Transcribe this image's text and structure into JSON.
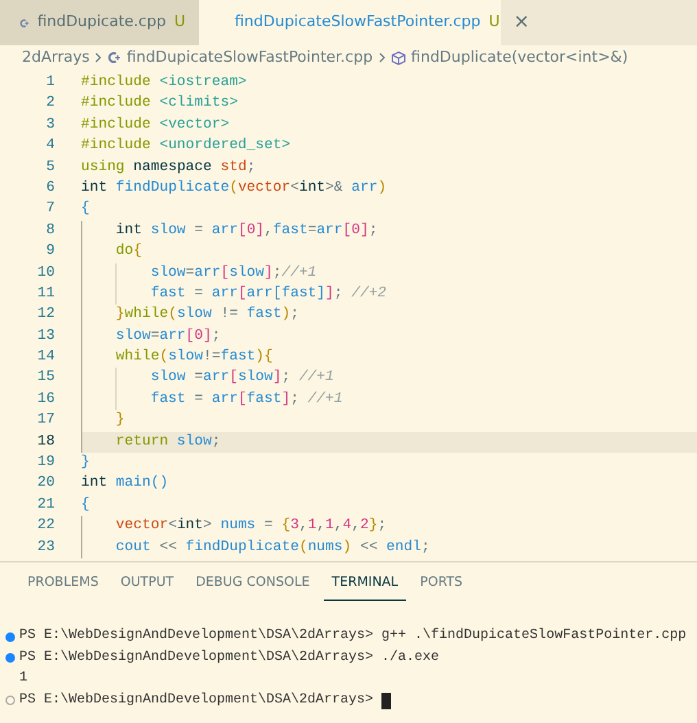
{
  "tabs": [
    {
      "label": "findDupicate.cpp",
      "badge": "U",
      "selected": false
    },
    {
      "label": "findDupicateSlowFastPointer.cpp",
      "badge": "U",
      "selected": true,
      "close": "×"
    }
  ],
  "breadcrumb": [
    {
      "label": "2dArrays",
      "kind": "folder"
    },
    {
      "label": "findDupicateSlowFastPointer.cpp",
      "kind": "file"
    },
    {
      "label": "findDuplicate(vector<int>&)",
      "kind": "symbol"
    }
  ],
  "code": [
    {
      "number": "1",
      "current": false,
      "tokens": [
        {
          "text": "#include",
          "kind": "pre"
        },
        {
          "text": " <iostream>",
          "kind": "inc"
        }
      ]
    },
    {
      "number": "2",
      "current": false,
      "tokens": [
        {
          "text": "#include",
          "kind": "pre"
        },
        {
          "text": " <climits>",
          "kind": "inc"
        }
      ]
    },
    {
      "number": "3",
      "current": false,
      "tokens": [
        {
          "text": "#include",
          "kind": "pre"
        },
        {
          "text": " <vector>",
          "kind": "inc"
        }
      ]
    },
    {
      "number": "4",
      "current": false,
      "tokens": [
        {
          "text": "#include",
          "kind": "pre"
        },
        {
          "text": " <unordered_set>",
          "kind": "inc"
        }
      ]
    },
    {
      "number": "5",
      "current": false,
      "tokens": [
        {
          "text": "using",
          "kind": "kw"
        },
        {
          "text": " namespace",
          "kind": "type"
        },
        {
          "text": " std",
          "kind": "ns"
        },
        {
          "text": ";",
          "kind": "op"
        }
      ]
    },
    {
      "number": "6",
      "current": false,
      "tokens": [
        {
          "text": "int",
          "kind": "type"
        },
        {
          "text": " findDuplicate",
          "kind": "fn"
        },
        {
          "text": "(",
          "kind": "b1"
        },
        {
          "text": "vector",
          "kind": "ns"
        },
        {
          "text": "<",
          "kind": "op"
        },
        {
          "text": "int",
          "kind": "type"
        },
        {
          "text": ">&",
          "kind": "op"
        },
        {
          "text": " arr",
          "kind": "var"
        },
        {
          "text": ")",
          "kind": "b1"
        }
      ]
    },
    {
      "number": "7",
      "current": false,
      "tokens": [
        {
          "text": "{",
          "kind": "b3"
        }
      ]
    },
    {
      "number": "8",
      "current": false,
      "tokens": [
        {
          "text": "    int",
          "kind": "type"
        },
        {
          "text": " slow",
          "kind": "var"
        },
        {
          "text": " = ",
          "kind": "op"
        },
        {
          "text": "arr",
          "kind": "var"
        },
        {
          "text": "[",
          "kind": "b2"
        },
        {
          "text": "0",
          "kind": "num"
        },
        {
          "text": "]",
          "kind": "b2"
        },
        {
          "text": ",",
          "kind": "op"
        },
        {
          "text": "fast",
          "kind": "var"
        },
        {
          "text": "=",
          "kind": "op"
        },
        {
          "text": "arr",
          "kind": "var"
        },
        {
          "text": "[",
          "kind": "b2"
        },
        {
          "text": "0",
          "kind": "num"
        },
        {
          "text": "]",
          "kind": "b2"
        },
        {
          "text": ";",
          "kind": "op"
        }
      ]
    },
    {
      "number": "9",
      "current": false,
      "tokens": [
        {
          "text": "    do",
          "kind": "kw"
        },
        {
          "text": "{",
          "kind": "b1"
        }
      ]
    },
    {
      "number": "10",
      "current": false,
      "tokens": [
        {
          "text": "        slow",
          "kind": "var"
        },
        {
          "text": "=",
          "kind": "op"
        },
        {
          "text": "arr",
          "kind": "var"
        },
        {
          "text": "[",
          "kind": "b2"
        },
        {
          "text": "slow",
          "kind": "var"
        },
        {
          "text": "]",
          "kind": "b2"
        },
        {
          "text": ";",
          "kind": "op"
        },
        {
          "text": "//+1",
          "kind": "cmt"
        }
      ]
    },
    {
      "number": "11",
      "current": false,
      "tokens": [
        {
          "text": "        fast",
          "kind": "var"
        },
        {
          "text": " = ",
          "kind": "op"
        },
        {
          "text": "arr",
          "kind": "var"
        },
        {
          "text": "[",
          "kind": "b2"
        },
        {
          "text": "arr",
          "kind": "var"
        },
        {
          "text": "[",
          "kind": "b3"
        },
        {
          "text": "fast",
          "kind": "var"
        },
        {
          "text": "]",
          "kind": "b3"
        },
        {
          "text": "]",
          "kind": "b2"
        },
        {
          "text": ";",
          "kind": "op"
        },
        {
          "text": " //+2",
          "kind": "cmt"
        }
      ]
    },
    {
      "number": "12",
      "current": false,
      "tokens": [
        {
          "text": "    }",
          "kind": "b1"
        },
        {
          "text": "while",
          "kind": "kw"
        },
        {
          "text": "(",
          "kind": "b1"
        },
        {
          "text": "slow",
          "kind": "var"
        },
        {
          "text": " != ",
          "kind": "op"
        },
        {
          "text": "fast",
          "kind": "var"
        },
        {
          "text": ")",
          "kind": "b1"
        },
        {
          "text": ";",
          "kind": "op"
        }
      ]
    },
    {
      "number": "13",
      "current": false,
      "tokens": [
        {
          "text": "    slow",
          "kind": "var"
        },
        {
          "text": "=",
          "kind": "op"
        },
        {
          "text": "arr",
          "kind": "var"
        },
        {
          "text": "[",
          "kind": "b2"
        },
        {
          "text": "0",
          "kind": "num"
        },
        {
          "text": "]",
          "kind": "b2"
        },
        {
          "text": ";",
          "kind": "op"
        }
      ]
    },
    {
      "number": "14",
      "current": false,
      "tokens": [
        {
          "text": "    while",
          "kind": "kw"
        },
        {
          "text": "(",
          "kind": "b1"
        },
        {
          "text": "slow",
          "kind": "var"
        },
        {
          "text": "!=",
          "kind": "op"
        },
        {
          "text": "fast",
          "kind": "var"
        },
        {
          "text": ")",
          "kind": "b1"
        },
        {
          "text": "{",
          "kind": "b1"
        }
      ]
    },
    {
      "number": "15",
      "current": false,
      "tokens": [
        {
          "text": "        slow",
          "kind": "var"
        },
        {
          "text": " =",
          "kind": "op"
        },
        {
          "text": "arr",
          "kind": "var"
        },
        {
          "text": "[",
          "kind": "b2"
        },
        {
          "text": "slow",
          "kind": "var"
        },
        {
          "text": "]",
          "kind": "b2"
        },
        {
          "text": ";",
          "kind": "op"
        },
        {
          "text": " //+1",
          "kind": "cmt"
        }
      ]
    },
    {
      "number": "16",
      "current": false,
      "tokens": [
        {
          "text": "        fast",
          "kind": "var"
        },
        {
          "text": " = ",
          "kind": "op"
        },
        {
          "text": "arr",
          "kind": "var"
        },
        {
          "text": "[",
          "kind": "b2"
        },
        {
          "text": "fast",
          "kind": "var"
        },
        {
          "text": "]",
          "kind": "b2"
        },
        {
          "text": ";",
          "kind": "op"
        },
        {
          "text": " //+1",
          "kind": "cmt"
        }
      ]
    },
    {
      "number": "17",
      "current": false,
      "tokens": [
        {
          "text": "    }",
          "kind": "b1"
        }
      ]
    },
    {
      "number": "18",
      "current": true,
      "tokens": [
        {
          "text": "    return",
          "kind": "kw"
        },
        {
          "text": " slow",
          "kind": "var"
        },
        {
          "text": ";",
          "kind": "op"
        }
      ]
    },
    {
      "number": "19",
      "current": false,
      "tokens": [
        {
          "text": "}",
          "kind": "b3"
        }
      ]
    },
    {
      "number": "20",
      "current": false,
      "tokens": [
        {
          "text": "int",
          "kind": "type"
        },
        {
          "text": " main",
          "kind": "fn"
        },
        {
          "text": "()",
          "kind": "b3"
        }
      ]
    },
    {
      "number": "21",
      "current": false,
      "tokens": [
        {
          "text": "{",
          "kind": "b3"
        }
      ]
    },
    {
      "number": "22",
      "current": false,
      "tokens": [
        {
          "text": "    vector",
          "kind": "ns"
        },
        {
          "text": "<",
          "kind": "op"
        },
        {
          "text": "int",
          "kind": "type"
        },
        {
          "text": ">",
          "kind": "op"
        },
        {
          "text": " nums",
          "kind": "var"
        },
        {
          "text": " = ",
          "kind": "op"
        },
        {
          "text": "{",
          "kind": "b1"
        },
        {
          "text": "3",
          "kind": "num"
        },
        {
          "text": ",",
          "kind": "op"
        },
        {
          "text": "1",
          "kind": "num"
        },
        {
          "text": ",",
          "kind": "op"
        },
        {
          "text": "1",
          "kind": "num"
        },
        {
          "text": ",",
          "kind": "op"
        },
        {
          "text": "4",
          "kind": "num"
        },
        {
          "text": ",",
          "kind": "op"
        },
        {
          "text": "2",
          "kind": "num"
        },
        {
          "text": "}",
          "kind": "b1"
        },
        {
          "text": ";",
          "kind": "op"
        }
      ]
    },
    {
      "number": "23",
      "current": false,
      "tokens": [
        {
          "text": "    cout",
          "kind": "var"
        },
        {
          "text": " << ",
          "kind": "op"
        },
        {
          "text": "findDuplicate",
          "kind": "fn"
        },
        {
          "text": "(",
          "kind": "b1"
        },
        {
          "text": "nums",
          "kind": "var"
        },
        {
          "text": ")",
          "kind": "b1"
        },
        {
          "text": " << ",
          "kind": "op"
        },
        {
          "text": "endl",
          "kind": "var"
        },
        {
          "text": ";",
          "kind": "op"
        }
      ]
    }
  ],
  "panel_tabs": [
    {
      "label": "PROBLEMS",
      "selected": false
    },
    {
      "label": "OUTPUT",
      "selected": false
    },
    {
      "label": "DEBUG CONSOLE",
      "selected": false
    },
    {
      "label": "TERMINAL",
      "selected": true
    },
    {
      "label": "PORTS",
      "selected": false
    }
  ],
  "terminal": [
    {
      "kind": "command",
      "text": "PS E:\\WebDesignAndDevelopment\\DSA\\2dArrays> g++ .\\findDupicateSlowFastPointer.cpp"
    },
    {
      "kind": "command",
      "text": "PS E:\\WebDesignAndDevelopment\\DSA\\2dArrays> ./a.exe"
    },
    {
      "kind": "output",
      "text": "1"
    },
    {
      "kind": "prompt",
      "text": "PS E:\\WebDesignAndDevelopment\\DSA\\2dArrays>"
    }
  ]
}
